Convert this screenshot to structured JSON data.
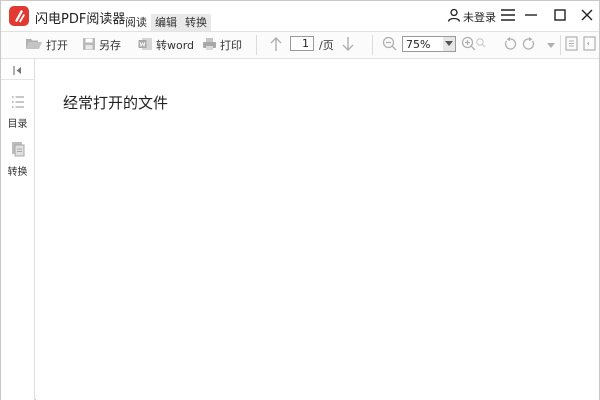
{
  "app": {
    "title": "闪电PDF阅读器"
  },
  "menu_tabs": [
    {
      "label": "阅读"
    },
    {
      "label": "编辑"
    },
    {
      "label": "转换"
    }
  ],
  "user": {
    "label": "未登录",
    "icon": "user-icon"
  },
  "window_controls": [
    "menu-icon",
    "minimize-icon",
    "maximize-icon",
    "close-icon"
  ],
  "toolbar": {
    "open_label": "打开",
    "save_as_label": "另存",
    "to_word_label": "转word",
    "print_label": "打印",
    "current_page": "1",
    "page_suffix": "/页",
    "zoom": "75%"
  },
  "sidebar": {
    "items": [
      {
        "label": "目录",
        "icon": "outline-list-icon"
      },
      {
        "label": "转换",
        "icon": "convert-doc-icon"
      }
    ]
  },
  "main": {
    "recent_title": "经常打开的文件"
  },
  "colors": {
    "brand": "#e03a32",
    "icon_gray": "#a8a8a8"
  }
}
